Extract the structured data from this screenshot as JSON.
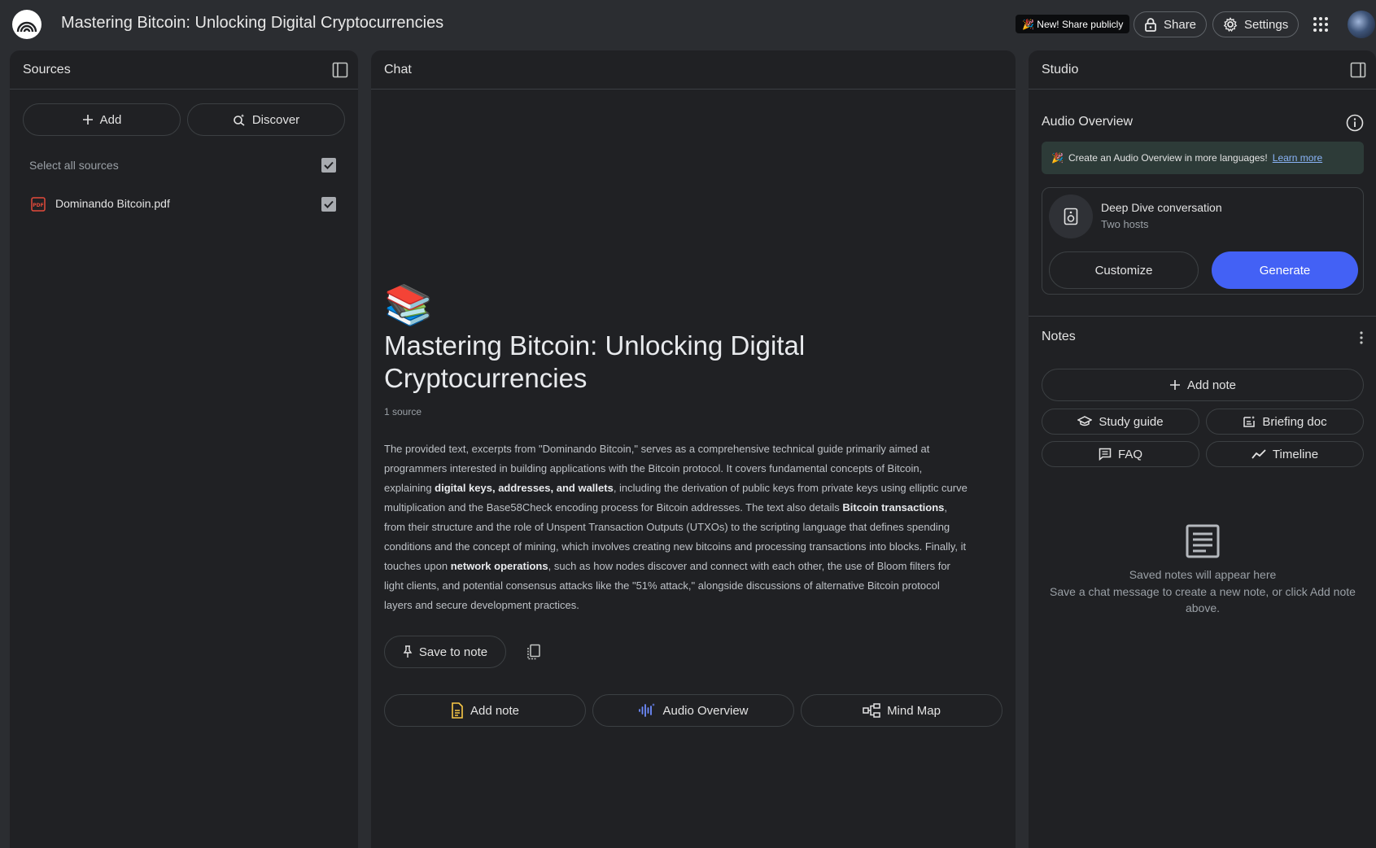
{
  "header": {
    "title": "Mastering Bitcoin: Unlocking Digital Cryptocurrencies",
    "share_publicly": "🎉 New! Share publicly",
    "share_label": "Share",
    "settings_label": "Settings"
  },
  "sources": {
    "title": "Sources",
    "add_label": "Add",
    "discover_label": "Discover",
    "select_all_label": "Select all sources",
    "items": [
      {
        "name": "Dominando Bitcoin.pdf",
        "checked": true
      }
    ]
  },
  "chat": {
    "title": "Chat",
    "emoji": "📚",
    "notebook_title": "Mastering Bitcoin: Unlocking Digital Cryptocurrencies",
    "source_count": "1 source",
    "summary": [
      {
        "text": "The provided text, excerpts from \"Dominando Bitcoin,\" serves as a comprehensive technical guide primarily aimed at programmers interested in building applications with the Bitcoin protocol. It covers fundamental concepts of Bitcoin, explaining ",
        "bold": false
      },
      {
        "text": "digital keys, addresses, and wallets",
        "bold": true
      },
      {
        "text": ", including the derivation of public keys from private keys using elliptic curve multiplication and the Base58Check encoding process for Bitcoin addresses. The text also details ",
        "bold": false
      },
      {
        "text": "Bitcoin transactions",
        "bold": true
      },
      {
        "text": ", from their structure and the role of Unspent Transaction Outputs (UTXOs) to the scripting language that defines spending conditions and the concept of mining, which involves creating new bitcoins and processing transactions into blocks. Finally, it touches upon ",
        "bold": false
      },
      {
        "text": "network operations",
        "bold": true
      },
      {
        "text": ", such as how nodes discover and connect with each other, the use of Bloom filters for light clients, and potential consensus attacks like the \"51% attack,\" alongside discussions of alternative Bitcoin protocol layers and secure development practices.",
        "bold": false
      }
    ],
    "save_to_note": "Save to note",
    "add_note": "Add note",
    "audio_overview": "Audio Overview",
    "mind_map": "Mind Map"
  },
  "studio": {
    "title": "Studio",
    "audio_overview_title": "Audio Overview",
    "banner_emoji": "🎉",
    "banner_text": "Create an Audio Overview in more languages!",
    "banner_link": "Learn more",
    "deep_dive_title": "Deep Dive conversation",
    "deep_dive_subtitle": "Two hosts",
    "customize_label": "Customize",
    "generate_label": "Generate",
    "notes_title": "Notes",
    "add_note_label": "Add note",
    "study_guide": "Study guide",
    "briefing_doc": "Briefing doc",
    "faq": "FAQ",
    "timeline": "Timeline",
    "empty_title": "Saved notes will appear here",
    "empty_desc": "Save a chat message to create a new note, or click Add note above."
  },
  "colors": {
    "background": "#2b2d31",
    "panel": "#202124",
    "accent": "#4361f5",
    "banner": "#2d3b38",
    "pdf_red": "#e24a3b",
    "note_yellow": "#f9c846",
    "audio_blue": "#6f8cff"
  }
}
